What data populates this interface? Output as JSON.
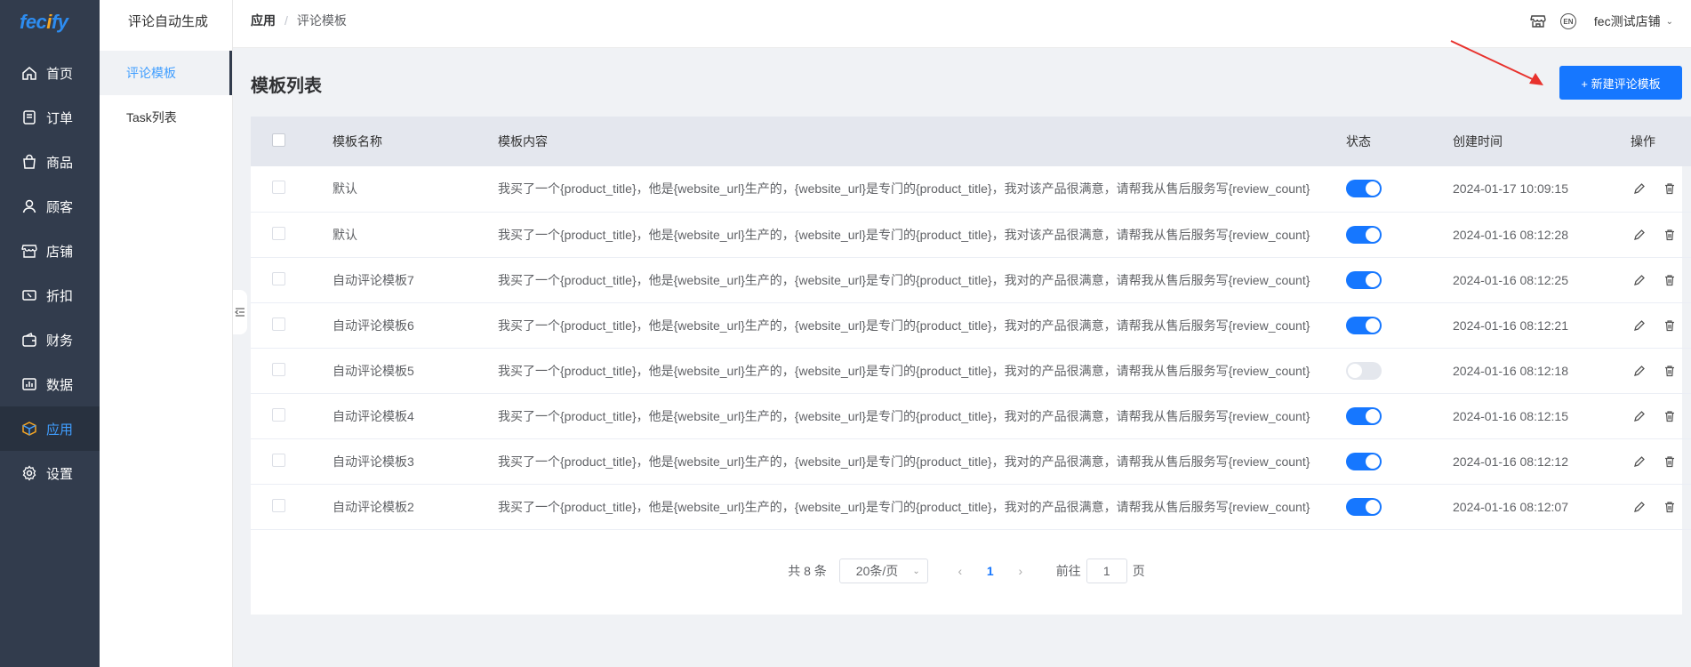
{
  "brand": {
    "logo_main": "fec",
    "logo_o": "i",
    "logo_tail": "fy"
  },
  "nav": {
    "items": [
      {
        "label": "首页",
        "icon": "home-icon"
      },
      {
        "label": "订单",
        "icon": "order-icon"
      },
      {
        "label": "商品",
        "icon": "bag-icon"
      },
      {
        "label": "顾客",
        "icon": "user-icon"
      },
      {
        "label": "店铺",
        "icon": "store-icon"
      },
      {
        "label": "折扣",
        "icon": "discount-icon"
      },
      {
        "label": "财务",
        "icon": "wallet-icon"
      },
      {
        "label": "数据",
        "icon": "chart-icon"
      },
      {
        "label": "应用",
        "icon": "box-icon"
      },
      {
        "label": "设置",
        "icon": "gear-icon"
      }
    ],
    "active_index": 8
  },
  "subnav": {
    "title": "评论自动生成",
    "items": [
      {
        "label": "评论模板"
      },
      {
        "label": "Task列表"
      }
    ]
  },
  "header": {
    "breadcrumb_root": "应用",
    "breadcrumb_sep": "/",
    "breadcrumb_current": "评论模板",
    "lang_badge": "EN",
    "store_name": "fec测试店铺"
  },
  "main": {
    "title": "模板列表",
    "new_button": "+ 新建评论模板"
  },
  "table": {
    "columns": [
      "模板名称",
      "模板内容",
      "状态",
      "创建时间",
      "操作"
    ],
    "rows": [
      {
        "name": "默认",
        "content": "我买了一个{product_title}，他是{website_url}生产的，{website_url}是专门的{product_title}，我对该产品很满意，请帮我从售后服务写{review_count}",
        "enabled": true,
        "created": "2024-01-17 10:09:15"
      },
      {
        "name": "默认",
        "content": "我买了一个{product_title}，他是{website_url}生产的，{website_url}是专门的{product_title}，我对该产品很满意，请帮我从售后服务写{review_count}",
        "enabled": true,
        "created": "2024-01-16 08:12:28"
      },
      {
        "name": "自动评论模板7",
        "content": "我买了一个{product_title}，他是{website_url}生产的，{website_url}是专门的{product_title}，我对的产品很满意，请帮我从售后服务写{review_count}",
        "enabled": true,
        "created": "2024-01-16 08:12:25"
      },
      {
        "name": "自动评论模板6",
        "content": "我买了一个{product_title}，他是{website_url}生产的，{website_url}是专门的{product_title}，我对的产品很满意，请帮我从售后服务写{review_count}",
        "enabled": true,
        "created": "2024-01-16 08:12:21"
      },
      {
        "name": "自动评论模板5",
        "content": "我买了一个{product_title}，他是{website_url}生产的，{website_url}是专门的{product_title}，我对的产品很满意，请帮我从售后服务写{review_count}",
        "enabled": false,
        "created": "2024-01-16 08:12:18"
      },
      {
        "name": "自动评论模板4",
        "content": "我买了一个{product_title}，他是{website_url}生产的，{website_url}是专门的{product_title}，我对的产品很满意，请帮我从售后服务写{review_count}",
        "enabled": true,
        "created": "2024-01-16 08:12:15"
      },
      {
        "name": "自动评论模板3",
        "content": "我买了一个{product_title}，他是{website_url}生产的，{website_url}是专门的{product_title}，我对的产品很满意，请帮我从售后服务写{review_count}",
        "enabled": true,
        "created": "2024-01-16 08:12:12"
      },
      {
        "name": "自动评论模板2",
        "content": "我买了一个{product_title}，他是{website_url}生产的，{website_url}是专门的{product_title}，我对的产品很满意，请帮我从售后服务写{review_count}",
        "enabled": true,
        "created": "2024-01-16 08:12:07"
      }
    ]
  },
  "pagination": {
    "total": "共 8 条",
    "page_size": "20条/页",
    "current_page": "1",
    "goto_prefix": "前往",
    "goto_value": "1",
    "goto_suffix": "页"
  },
  "colors": {
    "primary": "#1677ff",
    "nav_bg": "#323c4d",
    "active_text": "#409eff",
    "arrow": "#e8322d"
  }
}
